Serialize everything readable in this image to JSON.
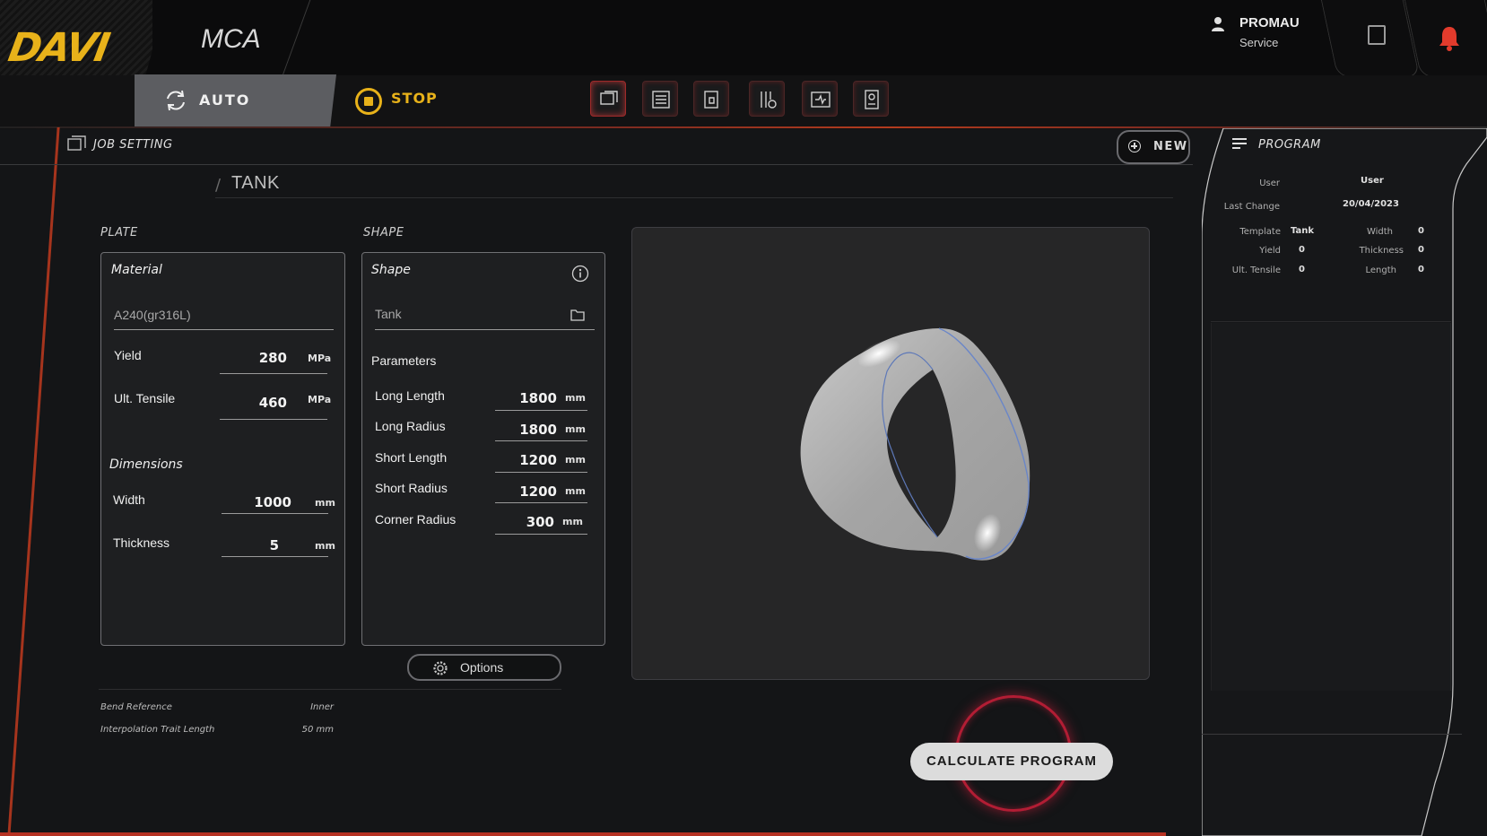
{
  "header": {
    "logo_text": "DAVI",
    "app_name": "MCA",
    "user": {
      "name": "PROMAU",
      "role": "Service"
    },
    "icons": [
      "user-icon",
      "note-icon",
      "bell-icon"
    ],
    "accent_color": "#e8b21a",
    "alert_color": "#e23b2c"
  },
  "modebar": {
    "auto_label": "AUTO",
    "stop_label": "STOP",
    "tools": [
      "job-setting-icon",
      "program-list-icon",
      "tooling-icon",
      "machine-settings-icon",
      "diagnostics-icon",
      "reports-icon"
    ]
  },
  "job": {
    "title": "JOB SETTING",
    "new_label": "NEW",
    "breadcrumb": "TANK",
    "plate_label": "PLATE",
    "shape_label": "SHAPE"
  },
  "plate": {
    "material_title": "Material",
    "material_value": "A240(gr316L)",
    "yield": {
      "label": "Yield",
      "value": "280",
      "unit": "MPa"
    },
    "ult_tensile": {
      "label": "Ult. Tensile",
      "value": "460",
      "unit": "MPa"
    },
    "dimensions_title": "Dimensions",
    "width": {
      "label": "Width",
      "value": "1000",
      "unit": "mm"
    },
    "thickness": {
      "label": "Thickness",
      "value": "5",
      "unit": "mm"
    }
  },
  "shape": {
    "title": "Shape",
    "value": "Tank",
    "parameters_title": "Parameters",
    "params": [
      {
        "label": "Long Length",
        "value": "1800",
        "unit": "mm"
      },
      {
        "label": "Long Radius",
        "value": "1800",
        "unit": "mm"
      },
      {
        "label": "Short Length",
        "value": "1200",
        "unit": "mm"
      },
      {
        "label": "Short Radius",
        "value": "1200",
        "unit": "mm"
      },
      {
        "label": "Corner Radius",
        "value": "300",
        "unit": "mm"
      }
    ],
    "options_label": "Options"
  },
  "bend": {
    "reference_label": "Bend Reference",
    "reference_value": "Inner",
    "trait_label": "Interpolation Trait Length",
    "trait_value": "50 mm"
  },
  "calculate_label": "CALCULATE PROGRAM",
  "program": {
    "title": "PROGRAM",
    "user_label": "User",
    "user_value": "User",
    "last_change_label": "Last Change",
    "last_change_value": "20/04/2023",
    "template_label": "Template",
    "template_value": "Tank",
    "width_label": "Width",
    "width_value": "0",
    "yield_label": "Yield",
    "yield_value": "0",
    "thickness_label": "Thickness",
    "thickness_value": "0",
    "ult_tensile_label": "Ult. Tensile",
    "ult_tensile_value": "0",
    "length_label": "Length",
    "length_value": "0"
  }
}
